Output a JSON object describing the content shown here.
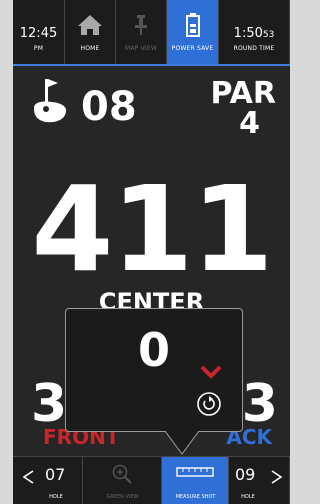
{
  "top_bar": {
    "time": "12:45",
    "time_period": "PM",
    "home_label": "HOME",
    "map_view_label": "MAP VIEW",
    "power_save_label": "POWER SAVE",
    "round_time_main": "1:50",
    "round_time_seconds": "53",
    "round_time_label": "ROUND TIME"
  },
  "hole": {
    "number": "08",
    "par_label": "PAR",
    "par_value": "4"
  },
  "distances": {
    "center": "411",
    "center_label": "CENTER",
    "front": "3",
    "front_label": "FRONT",
    "back": "23",
    "back_label": "ACK"
  },
  "measure_popup": {
    "value": "0"
  },
  "bottom_bar": {
    "prev_hole": "07",
    "prev_label": "HOLE",
    "green_view_label": "GREEN VIEW",
    "measure_shot_label": "MEASURE SHOT",
    "next_hole": "09",
    "next_label": "HOLE"
  },
  "colors": {
    "accent_blue": "#2f6fd6",
    "front_red": "#c8262c",
    "background": "#262626"
  },
  "icons": [
    "home-icon",
    "map-pin-icon",
    "battery-icon",
    "flag-icon",
    "down-arrow-icon",
    "reset-icon",
    "zoom-icon",
    "ruler-icon",
    "left-arrow-icon",
    "right-arrow-icon"
  ]
}
